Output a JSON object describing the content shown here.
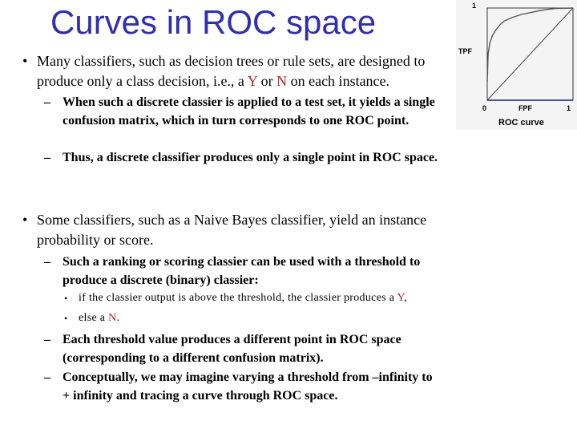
{
  "slide": {
    "title": "Curves in ROC space",
    "bullets": [
      {
        "text_before": "Many classifiers, such as decision trees or rule sets, are designed to produce only a class decision, i.e., a ",
        "y": "Y",
        "mid": " or ",
        "n": "N",
        "text_after": " on each instance.",
        "subs": [
          "When such a discrete classier is applied to a test set, it yields a single confusion matrix, which in turn corresponds to one ROC point.",
          "Thus, a discrete classifier produces only a single point in ROC space."
        ]
      },
      {
        "text": "Some classifiers, such as a Naive Bayes classifier, yield an instance probability or score.",
        "subs": [
          "Such a ranking or scoring classier can be used with a threshold to produce a discrete (binary) classier:",
          "Each threshold value produces a different point in ROC space (corresponding to a different confusion matrix).",
          "Conceptually, we may imagine varying a threshold from –infinity to + infinity and tracing a curve through ROC space."
        ],
        "subsubs": [
          {
            "before": "if the classier output is above the threshold, the classier produces a ",
            "red": "Y",
            "after": ","
          },
          {
            "before": "else a ",
            "red": "N",
            "after": "."
          }
        ]
      }
    ],
    "bullet_glyph": "•",
    "dash_glyph": "–"
  },
  "figure": {
    "caption": "ROC curve",
    "xlabel": "FPF",
    "ylabel": "TPF",
    "x_min_label": "0",
    "x_max_label": "1",
    "y_max_label": "1",
    "colors": {
      "title": "#2f2fb0",
      "highlight": "#b22222"
    }
  },
  "chart_data": {
    "type": "line",
    "title": "ROC curve",
    "xlabel": "FPF",
    "ylabel": "TPF",
    "xlim": [
      0,
      1
    ],
    "ylim": [
      0,
      1
    ],
    "series": [
      {
        "name": "ROC curve",
        "x": [
          0,
          0.01,
          0.03,
          0.06,
          0.1,
          0.15,
          0.2,
          0.3,
          0.4,
          0.5,
          0.6,
          0.7,
          0.8,
          1.0
        ],
        "y": [
          0.2,
          0.5,
          0.62,
          0.7,
          0.76,
          0.82,
          0.86,
          0.9,
          0.93,
          0.95,
          0.97,
          0.985,
          0.995,
          1.0
        ]
      },
      {
        "name": "diagonal",
        "x": [
          0,
          1
        ],
        "y": [
          0,
          1
        ]
      }
    ]
  }
}
